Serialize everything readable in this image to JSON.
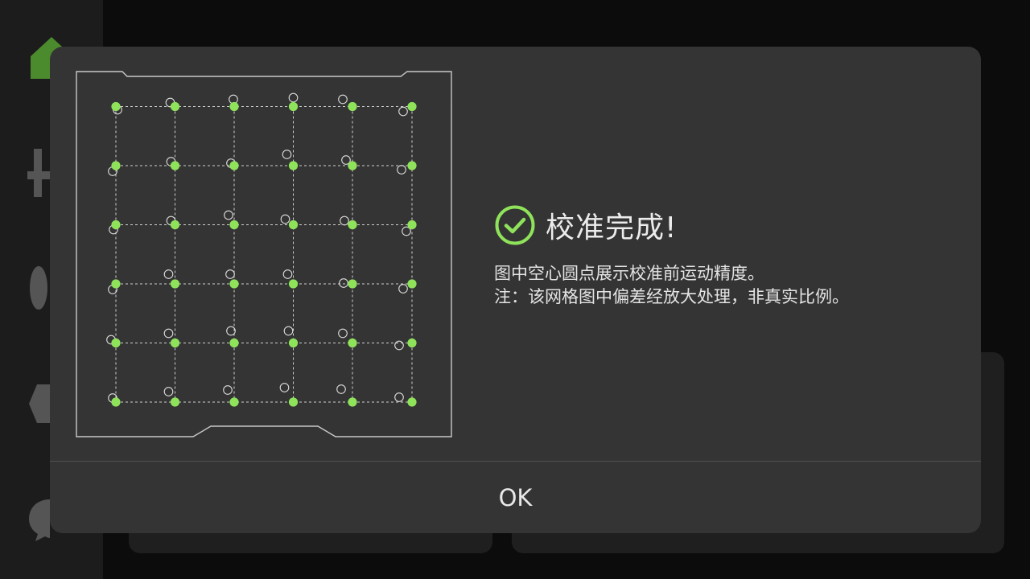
{
  "dialog": {
    "title": "校准完成!",
    "description_line1": "图中空心圆点展示校准前运动精度。",
    "description_line2": "注：该网格图中偏差经放大处理，非真实比例。",
    "ok_label": "OK"
  },
  "colors": {
    "accent": "#8fe35a",
    "dialog_bg": "#343434",
    "text": "#e8e8e8"
  },
  "icons": {
    "sidebar": [
      "home-icon",
      "tool-icon",
      "filament-icon",
      "settings-icon",
      "chat-icon"
    ],
    "status": "check-circle-icon"
  }
}
